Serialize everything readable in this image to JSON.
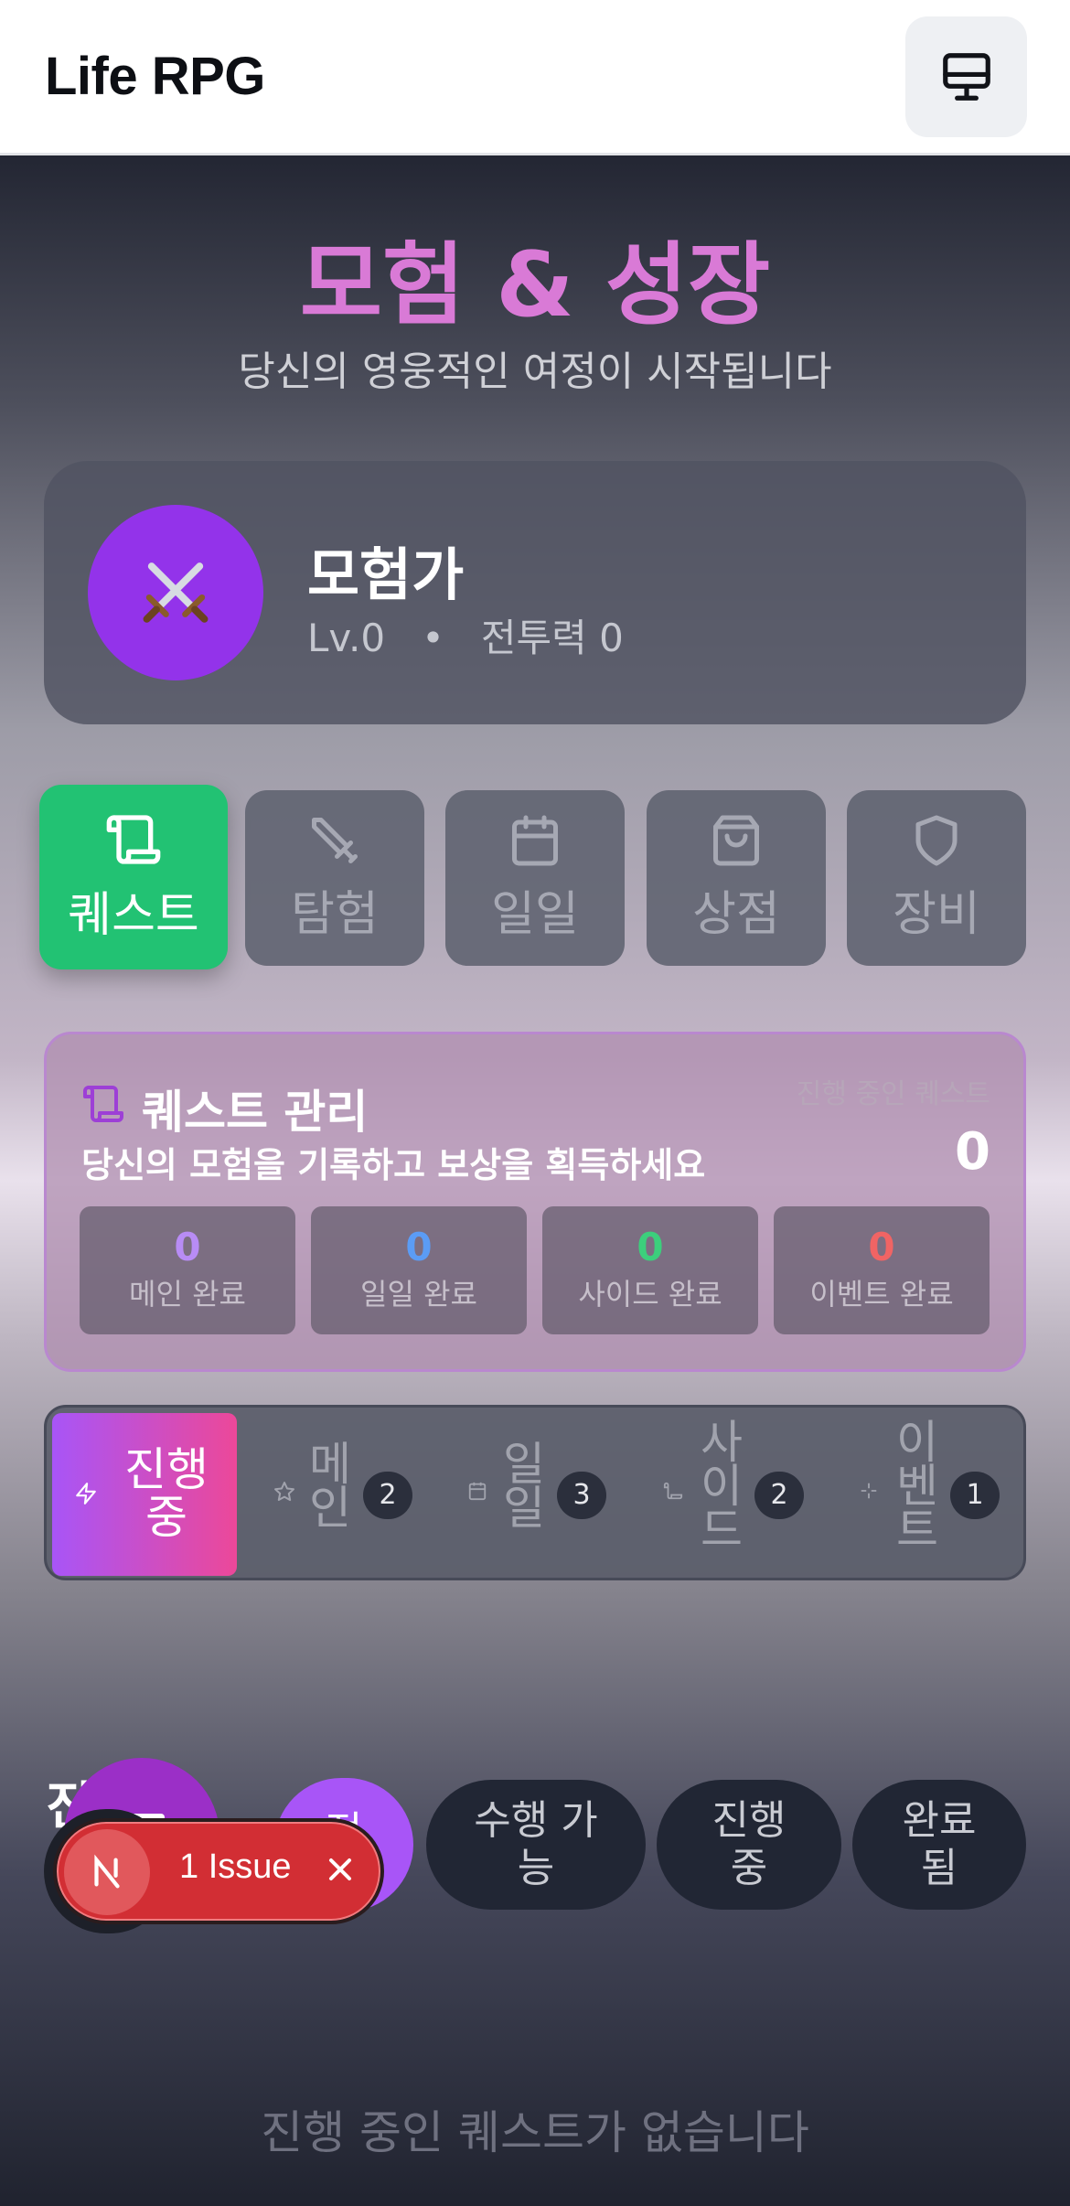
{
  "header": {
    "title": "Life RPG",
    "device_icon": "monitor-icon"
  },
  "hero": {
    "title": "모험 & 성장",
    "subtitle": "당신의 영웅적인 여정이 시작됩니다"
  },
  "profile": {
    "avatar_icon": "crossed-swords-icon",
    "name": "모험가",
    "level": "Lv.0",
    "separator": "•",
    "power": "전투력 0"
  },
  "nav": {
    "tabs": [
      {
        "label": "퀘스트",
        "icon": "scroll-icon",
        "active": true
      },
      {
        "label": "탐험",
        "icon": "sword-icon"
      },
      {
        "label": "일일",
        "icon": "calendar-icon"
      },
      {
        "label": "상점",
        "icon": "shopping-bag-icon"
      },
      {
        "label": "장비",
        "icon": "shield-icon"
      }
    ]
  },
  "quest_card": {
    "title": "퀘스트 관리",
    "description": "당신의 모험을 기록하고 보상을 획득하세요",
    "progress_label": "진행 중인 퀘스트",
    "progress_value": "0",
    "stats": [
      {
        "value": "0",
        "label": "메인 완료",
        "color": "#b88cf5"
      },
      {
        "value": "0",
        "label": "일일 완료",
        "color": "#5b9cf5"
      },
      {
        "value": "0",
        "label": "사이드 완료",
        "color": "#3ccf7c"
      },
      {
        "value": "0",
        "label": "이벤트 완료",
        "color": "#f06464"
      }
    ]
  },
  "filter_tabs": [
    {
      "label": "진행\n중",
      "icon": "lightning-icon",
      "active": true
    },
    {
      "label": "메\n인",
      "icon": "star-icon",
      "count": "2"
    },
    {
      "label": "일\n일",
      "icon": "calendar-icon",
      "count": "3"
    },
    {
      "label": "사\n이\n드",
      "icon": "scroll-icon",
      "count": "2"
    },
    {
      "label": "이\n벤\n트",
      "icon": "sparkle-icon",
      "count": "1"
    }
  ],
  "status_filter": {
    "section_title": "진",
    "options": [
      "전",
      "수행 가능",
      "진행 중",
      "완료 됨"
    ]
  },
  "issue_badge": {
    "label": "1 Issue"
  },
  "empty_message": "진행 중인 퀘스트가 없습니다"
}
